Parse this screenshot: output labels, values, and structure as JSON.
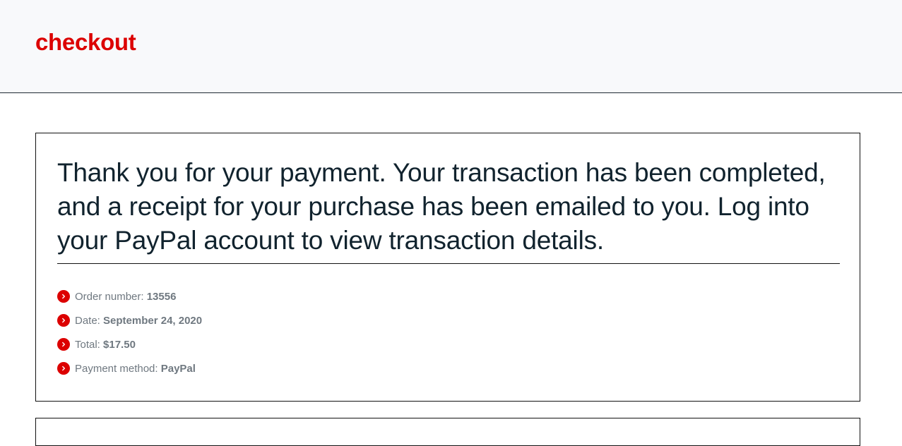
{
  "header": {
    "title": "checkout"
  },
  "confirmation": {
    "message": "Thank you for your payment. Your transaction has been completed, and a receipt for your purchase has been emailed to you. Log into your PayPal account to view transaction details."
  },
  "order_details": [
    {
      "label": "Order number: ",
      "value": "13556",
      "icon": "chevron-right-icon"
    },
    {
      "label": "Date: ",
      "value": "September 24, 2020",
      "icon": "chevron-right-icon"
    },
    {
      "label": "Total: ",
      "value": "$17.50",
      "icon": "chevron-right-icon"
    },
    {
      "label": "Payment method: ",
      "value": "PayPal",
      "icon": "chevron-right-icon"
    }
  ],
  "colors": {
    "accent": "#dc0000",
    "header_bg": "#f8f9fb",
    "text_dark": "#11232e",
    "text_muted": "#6f7880"
  }
}
